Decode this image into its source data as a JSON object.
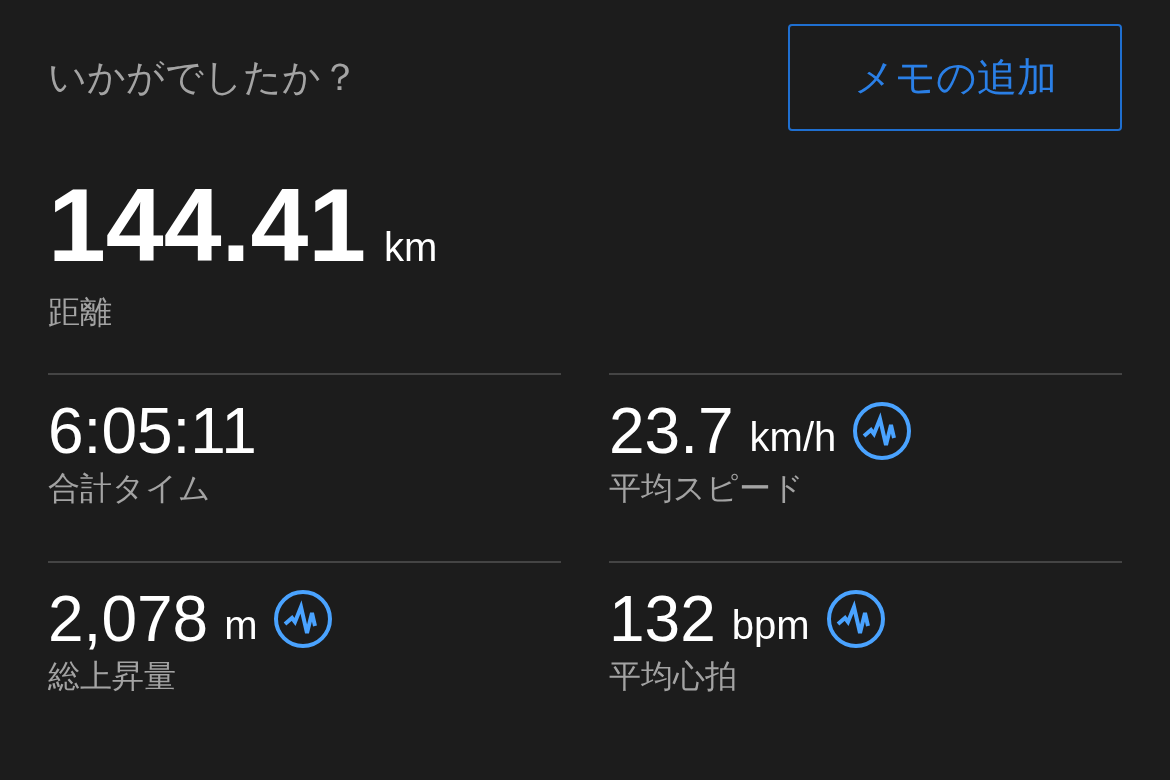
{
  "header": {
    "question": "いかがでしたか？",
    "button": "メモの追加"
  },
  "distance": {
    "value": "144.41",
    "unit": "km",
    "label": "距離"
  },
  "stats": [
    {
      "value": "6:05:11",
      "label": "合計タイム",
      "chart_badge": false
    },
    {
      "value": "23.7",
      "unit": "km/h",
      "label": "平均スピード",
      "chart_badge": true
    },
    {
      "value": "2,078",
      "unit": "m",
      "label": "総上昇量",
      "chart_badge": true
    },
    {
      "value": "132",
      "unit": "bpm",
      "label": "平均心拍",
      "chart_badge": true
    }
  ]
}
